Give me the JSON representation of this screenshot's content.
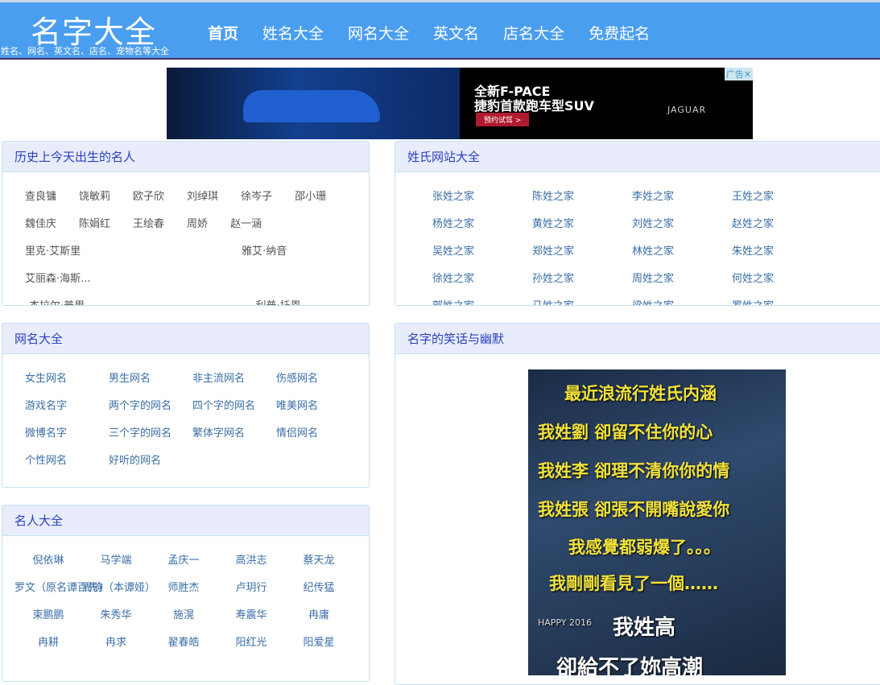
{
  "header": {
    "logo": "名字大全",
    "slogan": "姓名、网名、英文名、店名、宠物名等大全",
    "nav": [
      "首页",
      "姓名大全",
      "网名大全",
      "英文名",
      "店名大全",
      "免费起名"
    ]
  },
  "ad": {
    "line1": "全新F-PACE",
    "line2": "捷豹首款跑车型SUV",
    "button": "预约试驾 >",
    "brand": "JAGUAR",
    "label": "广告✕"
  },
  "celebs": {
    "title": "历史上今天出生的名人",
    "items": [
      "查良镛",
      "饶敏莉",
      "欧子欣",
      "刘绰琪",
      "徐岑子",
      "邵小珊",
      "魏佳庆",
      "陈娟红",
      "王绘春",
      "周娇",
      "赵一涵",
      "里克·艾斯里",
      "雅艾·纳音",
      "艾丽森·海斯...",
      "杰拉尔·普里...",
      "利普·托恩"
    ]
  },
  "surnames": {
    "title": "姓氏网站大全",
    "items": [
      "张姓之家",
      "陈姓之家",
      "李姓之家",
      "王姓之家",
      "杨姓之家",
      "黄姓之家",
      "刘姓之家",
      "赵姓之家",
      "吴姓之家",
      "郑姓之家",
      "林姓之家",
      "朱姓之家",
      "徐姓之家",
      "孙姓之家",
      "周姓之家",
      "何姓之家",
      "郭姓之家",
      "马姓之家",
      "梁姓之家",
      "罗姓之家"
    ]
  },
  "netnames": {
    "title": "网名大全",
    "items": [
      "女生网名",
      "男生网名",
      "非主流网名",
      "伤感网名",
      "游戏名字",
      "两个字的网名",
      "四个字的网名",
      "唯美网名",
      "微博名字",
      "三个字的网名",
      "繁体字网名",
      "情侣网名",
      "个性网名",
      "好听的网名"
    ]
  },
  "famous": {
    "title": "名人大全",
    "items": [
      "倪依琳",
      "马学端",
      "孟庆一",
      "高洪志",
      "蔡天龙",
      "罗文（原名谭百先）",
      "周驹（本谭娅）",
      "师胜杰",
      "卢玥行",
      "纪传猛",
      "束鹏鹏",
      "朱秀华",
      "施滉",
      "寿震华",
      "冉庸",
      "冉耕",
      "冉求",
      "翟春皓",
      "阳红光",
      "阳爱星"
    ]
  },
  "humor": {
    "title": "名字的笑话与幽默",
    "poster_lines": [
      "最近浪流行姓氏内涵",
      "我姓劉  卻留不住你的心",
      "我姓李  卻理不清你你的情",
      "我姓張  卻張不開嘴說愛你",
      "我感覺都弱爆了。。。",
      "我剛剛看見了一個……",
      "我姓高",
      "卻給不了妳高潮"
    ],
    "badge": "HAPPY 2016"
  }
}
